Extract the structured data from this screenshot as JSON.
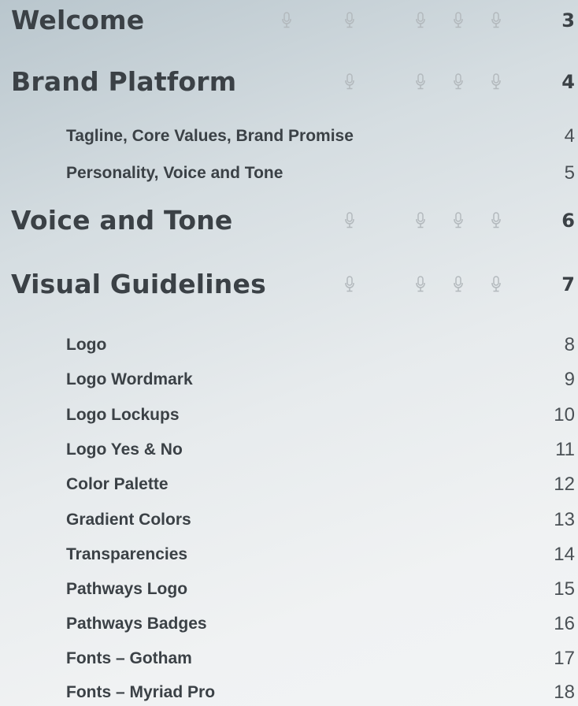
{
  "sections": [
    {
      "title": "Welcome",
      "page": "3",
      "icon": "microphone-icon"
    },
    {
      "title": "Brand Platform",
      "page": "4",
      "icon": "microphone-icon",
      "entries": [
        {
          "title": "Tagline, Core Values, Brand Promise",
          "page": "4"
        },
        {
          "title": "Personality, Voice and Tone",
          "page": "5"
        }
      ]
    },
    {
      "title": "Voice and Tone",
      "page": "6",
      "icon": "microphone-icon"
    },
    {
      "title": "Visual Guidelines",
      "page": "7",
      "icon": "microphone-icon",
      "entries": [
        {
          "title": "Logo",
          "page": "8"
        },
        {
          "title": "Logo Wordmark",
          "page": "9"
        },
        {
          "title": "Logo Lockups",
          "page": "10"
        },
        {
          "title": "Logo Yes & No",
          "page": "11"
        },
        {
          "title": "Color Palette",
          "page": "12"
        },
        {
          "title": "Gradient Colors",
          "page": "13"
        },
        {
          "title": "Transparencies",
          "page": "14"
        },
        {
          "title": "Pathways Logo",
          "page": "15"
        },
        {
          "title": "Pathways Badges",
          "page": "16"
        },
        {
          "title": "Fonts – Gotham",
          "page": "17"
        },
        {
          "title": "Fonts – Myriad Pro",
          "page": "18"
        }
      ]
    }
  ],
  "colors": {
    "text": "#3b4146",
    "icon": "#b3b9bd"
  }
}
